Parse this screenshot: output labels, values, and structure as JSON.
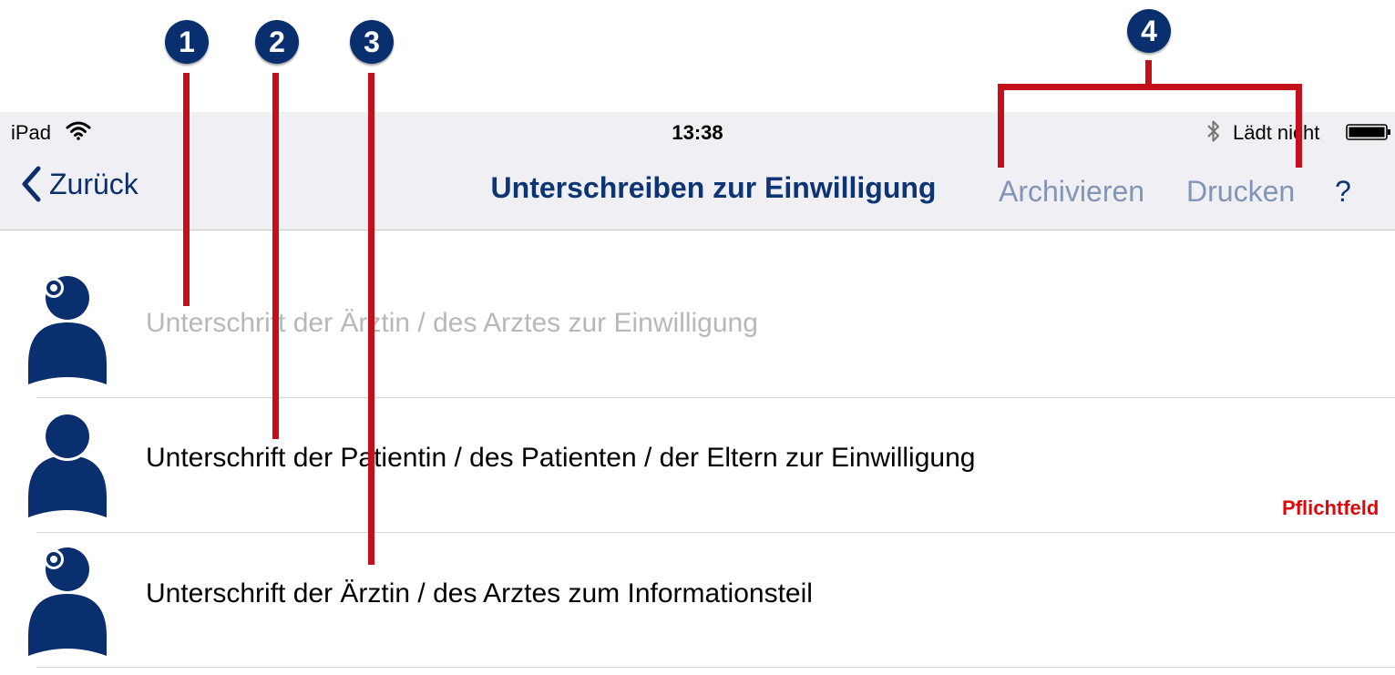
{
  "status_bar": {
    "carrier": "iPad",
    "time": "13:38",
    "charge_status": "Lädt nicht",
    "icons": [
      "wifi-icon",
      "bluetooth-icon",
      "battery-icon"
    ]
  },
  "nav_bar": {
    "back_label": "Zurück",
    "title": "Unterschreiben zur Einwilligung",
    "archive_label": "Archivieren",
    "print_label": "Drucken",
    "help_label": "?"
  },
  "signature_rows": [
    {
      "label": "Unterschrift der Ärztin / des Arztes zur Einwilligung",
      "avatar": "doctor-avatar-icon",
      "enabled": false
    },
    {
      "label": "Unterschrift der Patientin / des Patienten / der Eltern zur Einwilligung",
      "avatar": "patient-avatar-icon",
      "enabled": true,
      "required_label": "Pflichtfeld"
    },
    {
      "label": "Unterschrift der Ärztin / des Arztes zum Informationsteil",
      "avatar": "doctor-avatar-icon",
      "enabled": true
    }
  ],
  "annotations": [
    "1",
    "2",
    "3",
    "4"
  ],
  "colors": {
    "brand_navy": "#0a2f6e",
    "disabled_text": "#b8b8b8",
    "action_inactive": "#8195b6",
    "required_red": "#e0070b",
    "annotation_red": "#c4101b",
    "bar_background": "#efeff4"
  }
}
